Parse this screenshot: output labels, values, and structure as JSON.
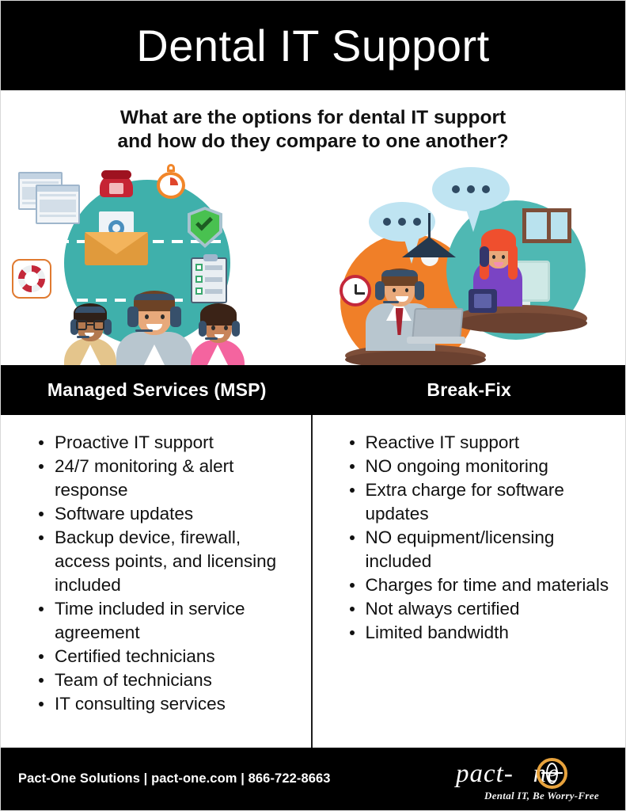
{
  "header": {
    "title": "Dental IT Support"
  },
  "subtitle": {
    "line1": "What are the options for dental IT support",
    "line2": "and how do they compare to one another?"
  },
  "columns": [
    {
      "id": "msp",
      "heading": "Managed Services (MSP)",
      "illustration": {
        "name": "support-team-illustration",
        "icons": [
          "browser-windows-icon",
          "telephone-icon",
          "stopwatch-icon",
          "email-gear-icon",
          "shield-check-icon",
          "life-ring-icon",
          "clipboard-checklist-icon",
          "support-agents-icon"
        ],
        "colors": {
          "circle": "#3FB0AB",
          "envelope": "#E09A3C",
          "shield": "#49C150",
          "phone": "#C62434"
        }
      },
      "bullets": [
        "Proactive IT support",
        "24/7 monitoring & alert response",
        "Software updates",
        "Backup device, firewall, access points, and licensing included",
        "Time included in service agreement",
        "Certified technicians",
        "Team of technicians",
        "IT consulting services"
      ]
    },
    {
      "id": "break-fix",
      "heading": "Break-Fix",
      "illustration": {
        "name": "call-center-illustration",
        "icons": [
          "speech-bubble-icon",
          "clock-icon",
          "desk-lamp-icon",
          "laptop-icon",
          "headset-agent-icon",
          "desk-phone-icon",
          "monitor-icon",
          "window-icon"
        ],
        "colors": {
          "circle_left": "#F07F28",
          "circle_right": "#4FB8B3",
          "bubble": "#BFE4F2"
        }
      },
      "bullets": [
        "Reactive IT support",
        "NO ongoing monitoring",
        "Extra charge for software updates",
        "NO equipment/licensing included",
        "Charges for time and materials",
        "Not always certified",
        "Limited bandwidth"
      ]
    }
  ],
  "footer": {
    "contact": "Pact-One Solutions | pact-one.com | 866-722-8663",
    "logo_word_left": "pact-",
    "logo_word_right": "ne",
    "logo_tagline": "Dental IT, Be Worry-Free",
    "logo_accent_color": "#E8A33D"
  }
}
